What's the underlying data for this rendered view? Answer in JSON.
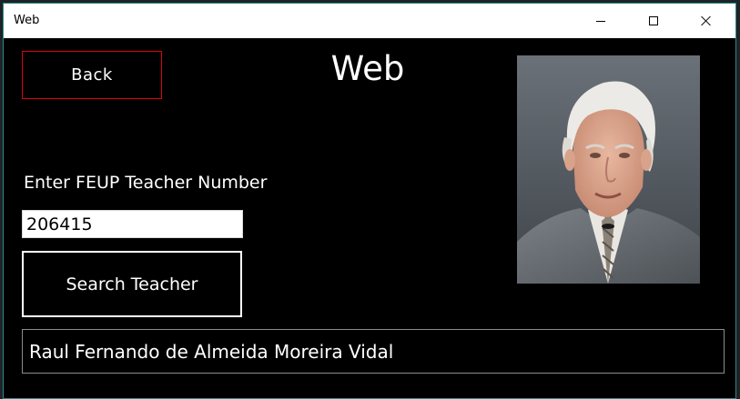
{
  "window": {
    "title": "Web"
  },
  "header": {
    "back_label": "Back",
    "page_title": "Web"
  },
  "form": {
    "field_label": "Enter FEUP Teacher Number",
    "teacher_number_value": "206415",
    "search_label": "Search Teacher"
  },
  "result": {
    "teacher_name": "Raul Fernando de Almeida Moreira Vidal"
  },
  "photo": {
    "icon": "teacher-photo",
    "alt": "Raul Fernando de Almeida Moreira Vidal"
  },
  "colors": {
    "background": "#000000",
    "text": "#ffffff",
    "back_border": "#e0000f",
    "search_border": "#ffffff",
    "result_border": "#8c8c8c"
  }
}
